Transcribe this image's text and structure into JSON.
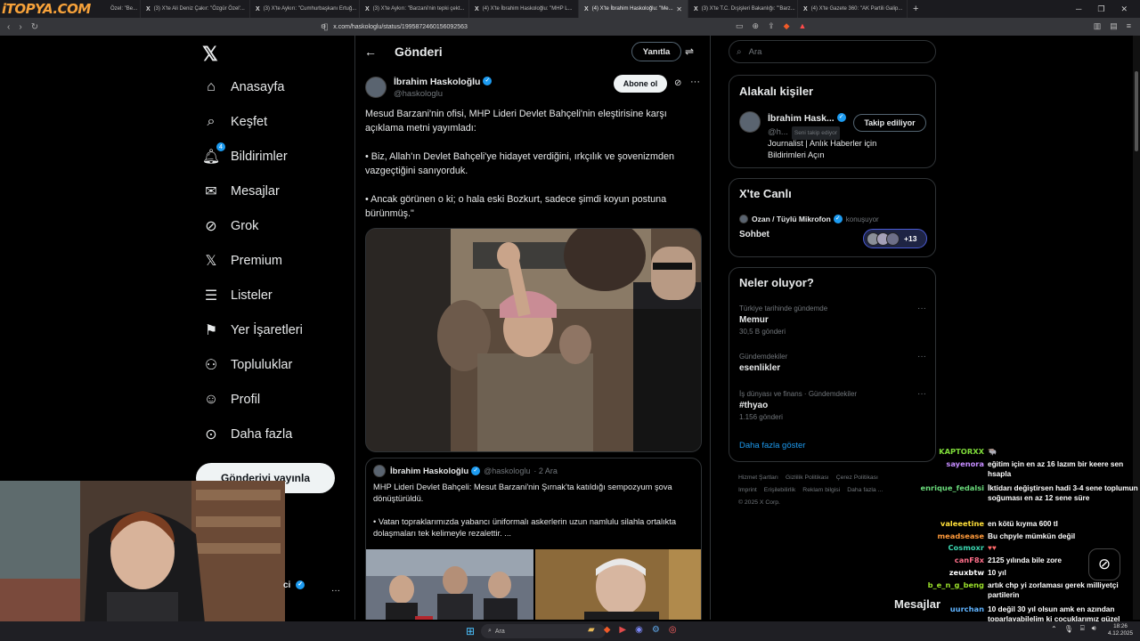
{
  "browser": {
    "brand": "iTOPYA.COM",
    "tabs": [
      {
        "label": "Özel: \"Be...",
        "active": false
      },
      {
        "label": "(3) X'te Ali Deniz Çakır: \"Özgür Özel'...",
        "active": false
      },
      {
        "label": "(3) X'te Aykırı: \"Cumhurbaşkanı Ertuğ...",
        "active": false
      },
      {
        "label": "(3) X'te Aykırı: \"Barzani'nin tepki çekt...",
        "active": false
      },
      {
        "label": "(4) X'te İbrahim Haskoloğlu: \"MHP L...",
        "active": false
      },
      {
        "label": "(4) X'te İbrahim Haskoloğlu: \"Me...",
        "active": true
      },
      {
        "label": "(3) X'te T.C. Dışişleri Bakanlığı: \"'Barz...",
        "active": false
      },
      {
        "label": "(4) X'te Gazete 360: \"AK Partili Galip...",
        "active": false
      }
    ],
    "url": "x.com/haskologlu/status/1995872460156092563"
  },
  "nav": {
    "items": [
      {
        "label": "Anasayfa",
        "icon": "home-icon"
      },
      {
        "label": "Keşfet",
        "icon": "search-icon"
      },
      {
        "label": "Bildirimler",
        "icon": "bell-icon",
        "badge": "4"
      },
      {
        "label": "Mesajlar",
        "icon": "mail-icon"
      },
      {
        "label": "Grok",
        "icon": "grok-icon"
      },
      {
        "label": "Premium",
        "icon": "x-premium-icon"
      },
      {
        "label": "Listeler",
        "icon": "list-icon"
      },
      {
        "label": "Yer İşaretleri",
        "icon": "bookmark-icon"
      },
      {
        "label": "Topluluklar",
        "icon": "communities-icon"
      },
      {
        "label": "Profil",
        "icon": "profile-icon"
      },
      {
        "label": "Daha fazla",
        "icon": "more-circle-icon"
      }
    ],
    "post_button": "Gönderiyi yayınla"
  },
  "main": {
    "header_title": "Gönderi",
    "reply_button": "Yanıtla",
    "author_name": "İbrahim Haskoloğlu",
    "author_handle": "@haskologlu",
    "follow_button": "Abone ol",
    "tweet_paragraphs": [
      "Mesud Barzani'nin ofisi, MHP Lideri Devlet Bahçeli'nin eleştirisine karşı açıklama metni yayımladı:",
      "• Biz, Allah'ın Devlet Bahçeli'ye hidayet verdiğini, ırkçılık ve şovenizmden vazgeçtiğini sanıyorduk.",
      "• Ancak görünen o ki; o hala eski Bozkurt, sadece şimdi koyun postuna bürünmüş.\""
    ],
    "quote": {
      "name": "İbrahim Haskoloğlu",
      "handle": "@haskologlu",
      "date": "· 2 Ara",
      "paragraphs": [
        "MHP Lideri Devlet Bahçeli: Mesut Barzani'nin Şırnak'ta katıldığı sempozyum şova dönüştürüldü.",
        "• Vatan topraklarımızda yabancı üniformalı askerlerin uzun namlulu silahla ortalıkta dolaşmaları tek kelimeyle rezalettir. ..."
      ]
    }
  },
  "right": {
    "search_placeholder": "Ara",
    "related_title": "Alakalı kişiler",
    "related_person": {
      "name": "İbrahim Hask...",
      "handle": "@h...",
      "follows_you": "Seni takip ediyor",
      "button": "Takip ediliyor",
      "bio": "Journalist | Anlık Haberler için Bildirimleri Açın"
    },
    "live_title": "X'te Canlı",
    "live": {
      "host": "Ozan / Tüylü Mikrofon",
      "status": "konuşuyor",
      "topic": "Sohbet",
      "listeners": "+13"
    },
    "trends_title": "Neler oluyor?",
    "trends": [
      {
        "context": "Türkiye tarihinde gündemde",
        "name": "Memur",
        "count": "30,5 B gönderi"
      },
      {
        "context": "Gündemdekiler",
        "name": "esenlikler",
        "count": ""
      },
      {
        "context": "İş dünyası ve finans · Gündemdekiler",
        "name": "#thyao",
        "count": "1.156 gönderi"
      }
    ],
    "show_more": "Daha fazla göster",
    "footer_links": [
      "Hizmet Şartları",
      "Gizlilik Politikası",
      "Çerez Politikası",
      "Imprint",
      "Erişilebilirlik",
      "Reklam bilgisi",
      "Daha fazla ...",
      "© 2025 X Corp."
    ]
  },
  "overlay": {
    "webcam_name_tail": "ci",
    "messages_bar": "Mesajlar",
    "chat": [
      {
        "user": "KAPTORXX",
        "color": "#7fdc3a",
        "msg": ""
      },
      {
        "user": "sayenora",
        "color": "#c58cff",
        "msg": "eğitim için en az 16 lazım bir keere sen hsapla"
      },
      {
        "user": "enrique_fedalsi",
        "color": "#69d97a",
        "msg": "İktidarı değiştirsen hadi 3-4 sene toplumun soğuması en az 12 sene süre"
      },
      {
        "user": "valeeetine",
        "color": "#ffdf3a",
        "msg": "en kötü kıyma 600 tl"
      },
      {
        "user": "meadsease",
        "color": "#ff9a3a",
        "msg": "Bu chpyle mümkün değil"
      },
      {
        "user": "Cosmoxr",
        "color": "#3ad6b0",
        "msg": ""
      },
      {
        "user": "canF8x",
        "color": "#ff6f8a",
        "msg": "2125 yılında bile zore"
      },
      {
        "user": "zeuxbtw",
        "color": "#ffffff",
        "msg": "10 yıl"
      },
      {
        "user": "b_e_n_g_beng",
        "color": "#9adf2a",
        "msg": "artık chp yi zorlaması gerek milliyetçi partilerin"
      },
      {
        "user": "uurchan",
        "color": "#5fb3ff",
        "msg": "10 değil 30 yıl olsun amk en azından toparlayabilelim ki çocuklarımız güzel yaşasın"
      }
    ]
  },
  "taskbar": {
    "search_label": "Ara",
    "time": "18:26",
    "date": "4.12.2025"
  }
}
